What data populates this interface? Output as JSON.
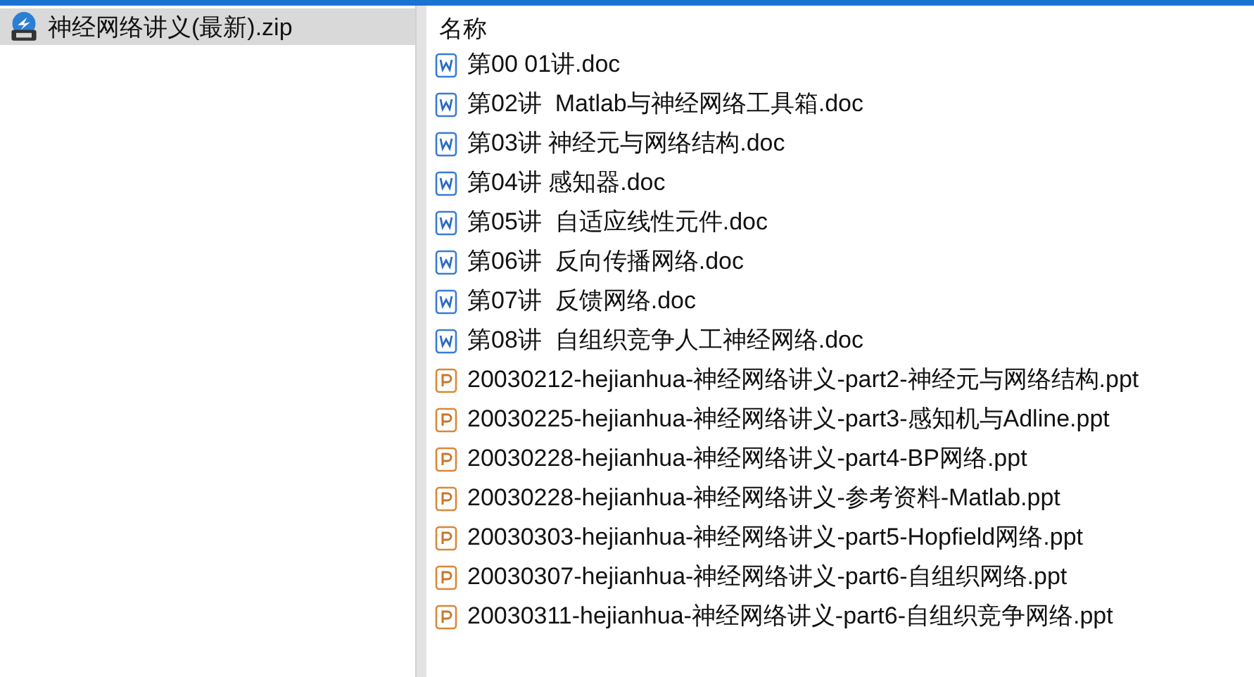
{
  "tree": {
    "items": [
      {
        "label": "神经网络讲义(最新).zip",
        "selected": true
      }
    ]
  },
  "list": {
    "columns": [
      "名称"
    ],
    "files": [
      {
        "kind": "doc",
        "name": "第00 01讲.doc"
      },
      {
        "kind": "doc",
        "name": "第02讲  Matlab与神经网络工具箱.doc"
      },
      {
        "kind": "doc",
        "name": "第03讲 神经元与网络结构.doc"
      },
      {
        "kind": "doc",
        "name": "第04讲 感知器.doc"
      },
      {
        "kind": "doc",
        "name": "第05讲  自适应线性元件.doc"
      },
      {
        "kind": "doc",
        "name": "第06讲  反向传播网络.doc"
      },
      {
        "kind": "doc",
        "name": "第07讲  反馈网络.doc"
      },
      {
        "kind": "doc",
        "name": "第08讲  自组织竞争人工神经网络.doc"
      },
      {
        "kind": "ppt",
        "name": "20030212-hejianhua-神经网络讲义-part2-神经元与网络结构.ppt"
      },
      {
        "kind": "ppt",
        "name": "20030225-hejianhua-神经网络讲义-part3-感知机与Adline.ppt"
      },
      {
        "kind": "ppt",
        "name": "20030228-hejianhua-神经网络讲义-part4-BP网络.ppt"
      },
      {
        "kind": "ppt",
        "name": "20030228-hejianhua-神经网络讲义-参考资料-Matlab.ppt"
      },
      {
        "kind": "ppt",
        "name": "20030303-hejianhua-神经网络讲义-part5-Hopfield网络.ppt"
      },
      {
        "kind": "ppt",
        "name": "20030307-hejianhua-神经网络讲义-part6-自组织网络.ppt"
      },
      {
        "kind": "ppt",
        "name": "20030311-hejianhua-神经网络讲义-part6-自组织竞争网络.ppt"
      }
    ]
  }
}
